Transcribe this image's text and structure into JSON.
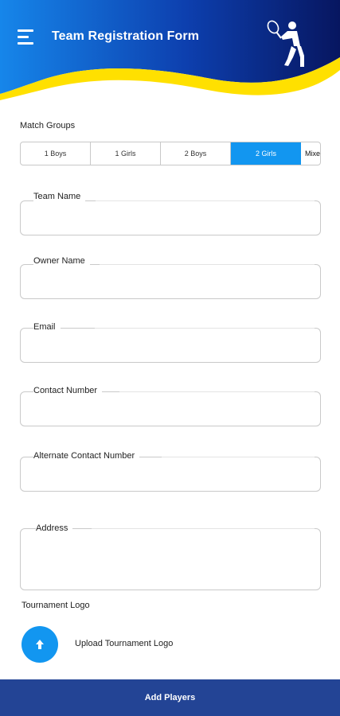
{
  "header": {
    "title": "Team Registration Form",
    "gradient_start": "#1580e8",
    "gradient_end": "#0a1a6e",
    "wave_color": "#ffe000"
  },
  "match_groups": {
    "label": "Match Groups",
    "options": [
      "1 Boys",
      "1 Girls",
      "2 Boys",
      "2 Girls",
      "Mixe"
    ],
    "selected": "2 Girls",
    "accent": "#1296f0"
  },
  "fields": {
    "team_name": {
      "label": "Team Name",
      "value": ""
    },
    "owner_name": {
      "label": "Owner Name",
      "value": ""
    },
    "email": {
      "label": "Email",
      "value": ""
    },
    "contact_number": {
      "label": "Contact Number",
      "value": ""
    },
    "alternate_contact": {
      "label": "Alternate Contact Number",
      "value": ""
    },
    "address": {
      "label": "Address",
      "value": ""
    }
  },
  "tournament_logo": {
    "label": "Tournament Logo",
    "upload_text": "Upload Tournament Logo",
    "icon": "arrow-up-icon"
  },
  "footer": {
    "add_players": "Add Players",
    "color": "#234495"
  }
}
